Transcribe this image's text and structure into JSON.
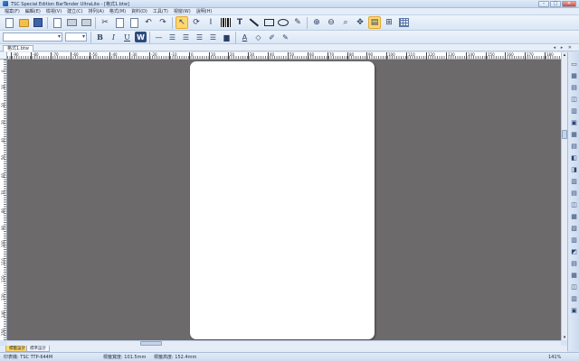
{
  "window": {
    "title": "TSC Special Edition BarTender UltraLite - [格式1.btw]",
    "minimize_glyph": "–",
    "maximize_glyph": "□",
    "close_glyph": "✕"
  },
  "menu": {
    "items": [
      "檔案(F)",
      "編輯(E)",
      "檢視(V)",
      "建立(C)",
      "排列(A)",
      "格式(M)",
      "資料(D)",
      "工具(T)",
      "視窗(W)",
      "說明(H)"
    ]
  },
  "toolbar1": {
    "text_tool_glyph": "T",
    "text_cursor_glyph": "I"
  },
  "toolbar2": {
    "font_name": "",
    "font_size": "",
    "bold": "B",
    "italic": "I",
    "underline": "U",
    "wrap": "W",
    "text_color_glyph": "A"
  },
  "document": {
    "tab_label": "格式1.btw",
    "controls": "◂ ▸ ✕"
  },
  "ruler_h": {
    "labels": [
      "-90",
      "-80",
      "-70",
      "-60",
      "-50",
      "-40",
      "-30",
      "-20",
      "-10",
      "0",
      "10",
      "20",
      "30",
      "40",
      "50",
      "60",
      "70",
      "80",
      "90",
      "100",
      "110",
      "120",
      "130",
      "140",
      "150",
      "160",
      "170",
      "180"
    ]
  },
  "ruler_v": {
    "labels": [
      "0",
      "10",
      "20",
      "30",
      "40",
      "50",
      "60",
      "70",
      "80",
      "90",
      "100",
      "110",
      "120",
      "130",
      "140",
      "150"
    ]
  },
  "bottom_tabs": {
    "active": "標籤設計",
    "inactive": "標準設計"
  },
  "status": {
    "printer": "印表機: TSC TTP-644M",
    "label_width": "標籤寬度: 101.5mm",
    "label_height": "標籤高度: 152.4mm",
    "zoom": "141%"
  },
  "colors": {
    "canvas": "#6d6a6c",
    "page": "#ffffff",
    "active_tool": "#ffd76e",
    "chrome": "#d6e3f3"
  }
}
